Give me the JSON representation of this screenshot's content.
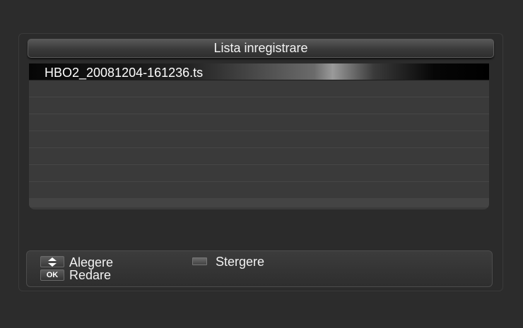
{
  "title": "Lista inregistrare",
  "recordings": [
    {
      "name": "HBO2_20081204-161236.ts",
      "selected": true
    },
    {
      "name": "",
      "selected": false
    },
    {
      "name": "",
      "selected": false
    },
    {
      "name": "",
      "selected": false
    },
    {
      "name": "",
      "selected": false
    },
    {
      "name": "",
      "selected": false
    },
    {
      "name": "",
      "selected": false
    },
    {
      "name": "",
      "selected": false
    }
  ],
  "help": {
    "select_label": "Alegere",
    "delete_label": "Stergere",
    "edit_label": "Redare",
    "ok_key": "OK"
  },
  "icons": {
    "select": "up-down-arrows-icon",
    "delete": "red-key-icon",
    "edit": "ok-key-icon"
  }
}
